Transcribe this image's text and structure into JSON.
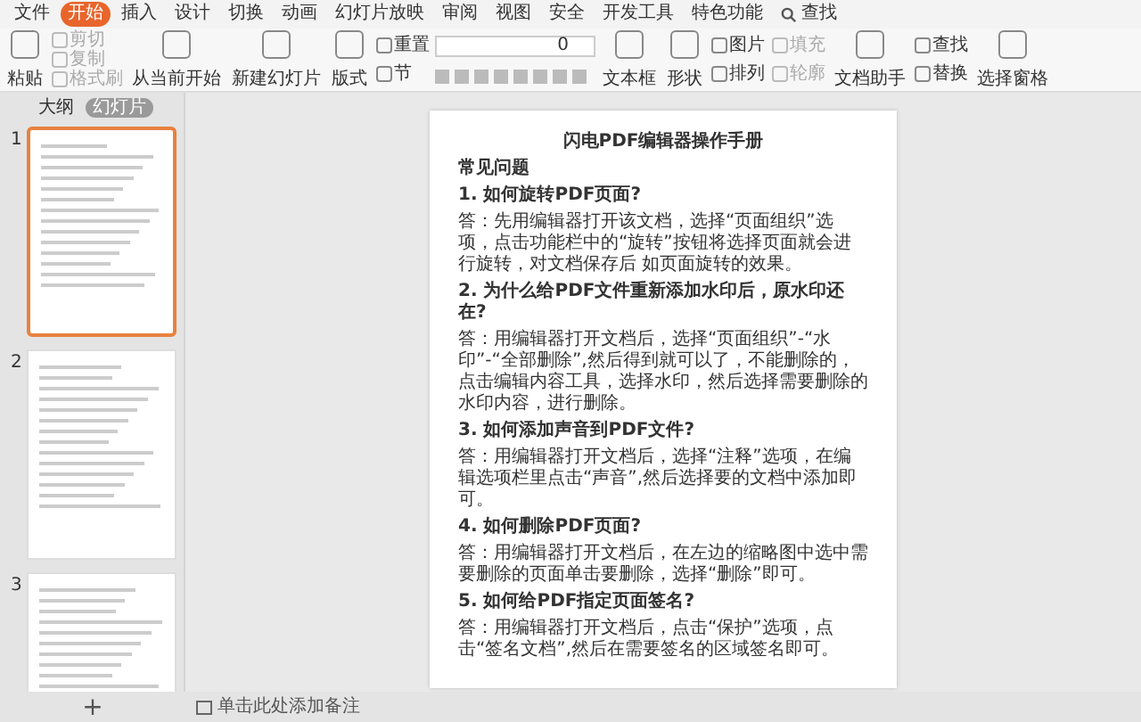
{
  "menu": {
    "label": "文件"
  },
  "tabs": [
    {
      "label": "开始",
      "selected": true
    },
    {
      "label": "插入",
      "selected": false
    },
    {
      "label": "设计",
      "selected": false
    },
    {
      "label": "切换",
      "selected": false
    },
    {
      "label": "动画",
      "selected": false
    },
    {
      "label": "幻灯片放映",
      "selected": false
    },
    {
      "label": "审阅",
      "selected": false
    },
    {
      "label": "视图",
      "selected": false
    },
    {
      "label": "安全",
      "selected": false
    },
    {
      "label": "开发工具",
      "selected": false
    },
    {
      "label": "特色功能",
      "selected": false
    }
  ],
  "search": {
    "label": "查找"
  },
  "toolbar": [
    {
      "kind": "large",
      "label": "粘贴"
    },
    {
      "kind": "stack",
      "items": [
        {
          "label": "剪切",
          "disabled": true
        },
        {
          "label": "复制",
          "disabled": true
        },
        {
          "label": "格式刷",
          "disabled": true
        }
      ]
    },
    {
      "kind": "large",
      "label": "从当前开始"
    },
    {
      "kind": "large",
      "label": "新建幻灯片"
    },
    {
      "kind": "large",
      "label": "版式"
    },
    {
      "kind": "stack",
      "items": [
        {
          "label": "重置",
          "disabled": false
        },
        {
          "label": "节",
          "disabled": false
        }
      ]
    },
    {
      "kind": "font",
      "size": "0"
    },
    {
      "kind": "large",
      "label": "文本框"
    },
    {
      "kind": "large",
      "label": "形状"
    },
    {
      "kind": "stack",
      "items": [
        {
          "label": "图片",
          "disabled": false
        },
        {
          "label": "排列",
          "disabled": false
        }
      ]
    },
    {
      "kind": "stack",
      "items": [
        {
          "label": "填充",
          "disabled": true
        },
        {
          "label": "轮廓",
          "disabled": true
        }
      ]
    },
    {
      "kind": "large",
      "label": "文档助手"
    },
    {
      "kind": "stack",
      "items": [
        {
          "label": "查找",
          "disabled": false
        },
        {
          "label": "替换",
          "disabled": false
        }
      ]
    },
    {
      "kind": "large",
      "label": "选择窗格"
    }
  ],
  "sidebar": {
    "views": [
      {
        "label": "大纲",
        "selected": false
      },
      {
        "label": "幻灯片",
        "selected": true
      }
    ],
    "slides": [
      {
        "number": "1",
        "selected": true
      },
      {
        "number": "2",
        "selected": false
      },
      {
        "number": "3",
        "selected": false
      }
    ],
    "add_label": "+"
  },
  "document": {
    "title": "闪电PDF编辑器操作手册",
    "blocks": [
      {
        "kind": "heading",
        "text": "常见问题"
      },
      {
        "kind": "question",
        "text": "1. 如何旋转PDF页面?"
      },
      {
        "kind": "answer",
        "text": "答：先用编辑器打开该文档，选择“页面组织”选项，点击功能栏中的“旋转”按钮将选择页面就会进行旋转，对文档保存后 如页面旋转的效果。"
      },
      {
        "kind": "question",
        "text": "2. 为什么给PDF文件重新添加水印后，原水印还在?"
      },
      {
        "kind": "answer",
        "text": "答：用编辑器打开文档后，选择“页面组织”-“水印”-“全部删除”,然后得到就可以了，不能删除的，点击编辑内容工具，选择水印，然后选择需要删除的水印内容，进行删除。"
      },
      {
        "kind": "question",
        "text": "3. 如何添加声音到PDF文件?"
      },
      {
        "kind": "answer",
        "text": "答：用编辑器打开文档后，选择“注释”选项，在编辑选项栏里点击“声音”,然后选择要的文档中添加即可。"
      },
      {
        "kind": "question",
        "text": "4. 如何删除PDF页面?"
      },
      {
        "kind": "answer",
        "text": "答：用编辑器打开文档后，在左边的缩略图中选中需要删除的页面单击要删除，选择“删除”即可。"
      },
      {
        "kind": "question",
        "text": "5. 如何给PDF指定页面签名?"
      },
      {
        "kind": "answer",
        "text": "答：用编辑器打开文档后，点击“保护”选项，点击“签名文档”,然后在需要签名的区域签名即可。"
      }
    ]
  },
  "notes": {
    "placeholder": "单击此处添加备注"
  }
}
